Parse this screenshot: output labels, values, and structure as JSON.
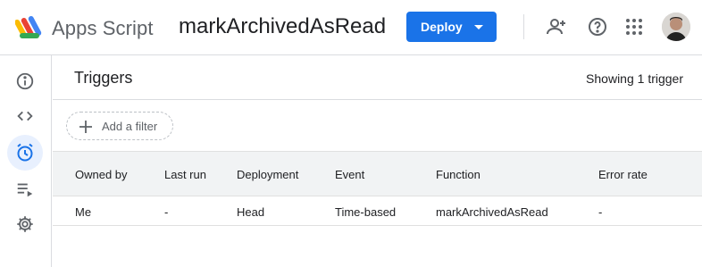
{
  "header": {
    "app_name": "Apps Script",
    "project_title": "markArchivedAsRead",
    "deploy_label": "Deploy",
    "icons": [
      "add-person-icon",
      "help-icon",
      "apps-grid-icon"
    ]
  },
  "sidebar": {
    "items": [
      {
        "name": "overview",
        "icon": "info-icon"
      },
      {
        "name": "editor",
        "icon": "code-icon"
      },
      {
        "name": "triggers",
        "icon": "alarm-clock-icon",
        "active": true
      },
      {
        "name": "executions",
        "icon": "list-play-icon"
      },
      {
        "name": "settings",
        "icon": "gear-icon"
      }
    ]
  },
  "main": {
    "title": "Triggers",
    "count_text": "Showing 1 trigger",
    "filter_label": "Add a filter",
    "table": {
      "columns": [
        "Owned by",
        "Last run",
        "Deployment",
        "Event",
        "Function",
        "Error rate"
      ],
      "rows": [
        [
          "Me",
          "-",
          "Head",
          "Time-based",
          "markArchivedAsRead",
          "-"
        ]
      ]
    }
  },
  "colors": {
    "accent": "#1a73e8",
    "active_bg": "#e8f0fe",
    "header_row_bg": "#f1f3f4",
    "icon_gray": "#5f6368"
  }
}
